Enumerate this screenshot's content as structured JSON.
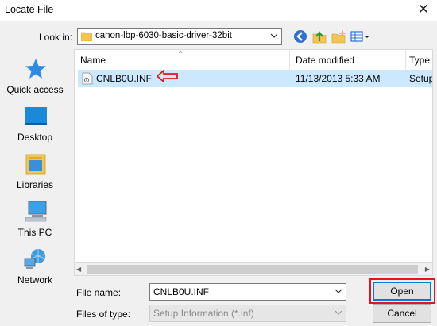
{
  "window": {
    "title": "Locate File",
    "close_glyph": "✕"
  },
  "lookin": {
    "label": "Look in:",
    "path": "canon-lbp-6030-basic-driver-32bit"
  },
  "toolbar": {
    "icons": [
      "back-icon",
      "up-folder-icon",
      "new-folder-icon",
      "view-menu-icon"
    ]
  },
  "places": [
    {
      "label": "Quick access",
      "icon": "star-icon"
    },
    {
      "label": "Desktop",
      "icon": "desktop-icon"
    },
    {
      "label": "Libraries",
      "icon": "libraries-icon"
    },
    {
      "label": "This PC",
      "icon": "computer-icon"
    },
    {
      "label": "Network",
      "icon": "network-icon"
    }
  ],
  "filelist": {
    "columns": [
      "Name",
      "Date modified",
      "Type"
    ],
    "rows": [
      {
        "name": "CNLB0U.INF",
        "date": "11/13/2013 5:33 AM",
        "type": "Setup",
        "selected": true
      }
    ]
  },
  "annotation": {
    "color": "#e0161a"
  },
  "form": {
    "filename_label": "File name:",
    "filename_value": "CNLB0U.INF",
    "filetype_label": "Files of type:",
    "filetype_value": "Setup Information (*.inf)"
  },
  "buttons": {
    "open": "Open",
    "cancel": "Cancel"
  },
  "colors": {
    "selection": "#cce8ff",
    "accent": "#0078d7",
    "highlight": "#e0161a"
  }
}
